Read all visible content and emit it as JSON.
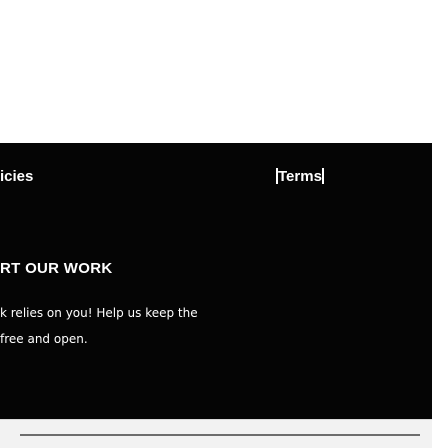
{
  "nav": {
    "policies_partial": "icies",
    "terms": "Terms"
  },
  "support": {
    "heading_partial": "RT OUR WORK",
    "line1": "k relies on you! Help us keep the",
    "line2": "free and open."
  },
  "colors": {
    "panel": "#050505",
    "text": "#ffffff",
    "page": "#ffffff"
  }
}
